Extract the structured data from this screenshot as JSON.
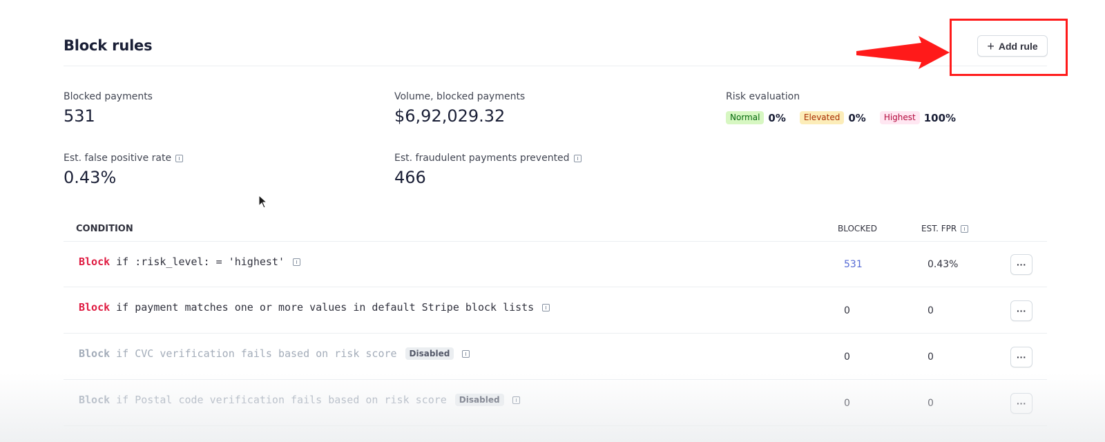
{
  "header": {
    "title": "Block rules",
    "add_rule_label": "Add rule"
  },
  "stats": {
    "blocked_payments": {
      "label": "Blocked payments",
      "value": "531"
    },
    "volume_blocked": {
      "label": "Volume, blocked payments",
      "value": "$6,92,029.32"
    },
    "risk_evaluation": {
      "label": "Risk evaluation",
      "levels": [
        {
          "name": "Normal",
          "value": "0%"
        },
        {
          "name": "Elevated",
          "value": "0%"
        },
        {
          "name": "Highest",
          "value": "100%"
        }
      ]
    },
    "false_positive_rate": {
      "label": "Est. false positive rate",
      "value": "0.43%"
    },
    "fraud_prevented": {
      "label": "Est. fraudulent payments prevented",
      "value": "466"
    }
  },
  "table": {
    "columns": {
      "condition": "CONDITION",
      "blocked": "BLOCKED",
      "est_fpr": "EST. FPR"
    },
    "rows": [
      {
        "keyword": "Block",
        "condition": "if :risk_level: = 'highest'",
        "badge": "",
        "blocked": "531",
        "est_fpr": "0.43%"
      },
      {
        "keyword": "Block",
        "condition": "if payment matches one or more values in default Stripe block lists",
        "badge": "",
        "blocked": "0",
        "est_fpr": "0"
      },
      {
        "keyword": "Block",
        "condition": "if CVC verification fails based on risk score",
        "badge": "Disabled",
        "blocked": "0",
        "est_fpr": "0"
      },
      {
        "keyword": "Block",
        "condition": "if Postal code verification fails based on risk score",
        "badge": "Disabled",
        "blocked": "0",
        "est_fpr": "0"
      }
    ],
    "more_label": "···"
  },
  "colors": {
    "annotation": "#ff1a1a",
    "block_keyword": "#df1b41",
    "link": "#5469d4"
  }
}
